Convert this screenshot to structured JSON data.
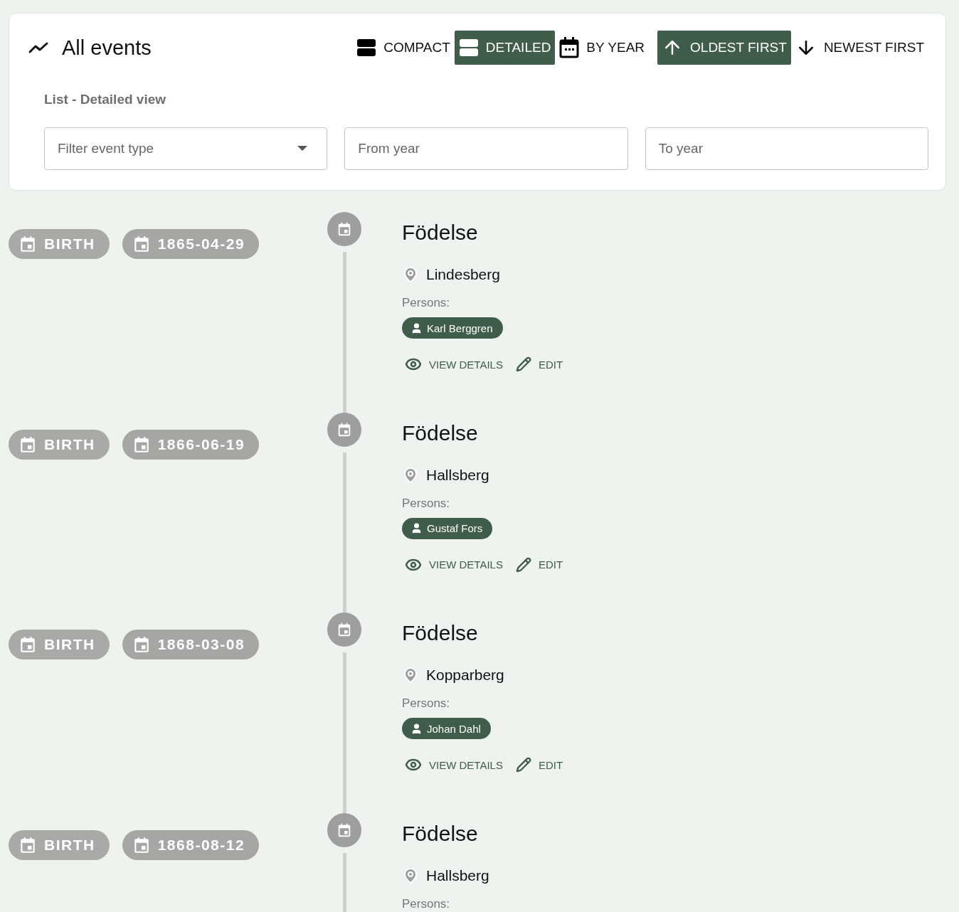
{
  "header": {
    "title": "All events",
    "subtitle": "List - Detailed view"
  },
  "view_buttons": [
    {
      "kind": "compact",
      "label": "COMPACT",
      "selected": false
    },
    {
      "kind": "detailed",
      "label": "DETAILED",
      "selected": true
    },
    {
      "kind": "year",
      "label": "BY YEAR",
      "selected": false
    }
  ],
  "sort_buttons": [
    {
      "kind": "oldest",
      "label": "OLDEST FIRST",
      "selected": true
    },
    {
      "kind": "newest",
      "label": "NEWEST FIRST",
      "selected": false
    }
  ],
  "filters": [
    {
      "kind": "select",
      "placeholder": "Filter event type"
    },
    {
      "kind": "text",
      "placeholder": "From year"
    },
    {
      "kind": "text",
      "placeholder": "To year"
    }
  ],
  "events": [
    {
      "type": "BIRTH",
      "date": "1865-04-29",
      "title": "Födelse",
      "place": "Lindesberg",
      "persons_label": "Persons:",
      "persons": [
        "Karl Berggren"
      ],
      "actions": [
        {
          "kind": "view",
          "label": "VIEW DETAILS"
        },
        {
          "kind": "edit",
          "label": "EDIT"
        }
      ]
    },
    {
      "type": "BIRTH",
      "date": "1866-06-19",
      "title": "Födelse",
      "place": "Hallsberg",
      "persons_label": "Persons:",
      "persons": [
        "Gustaf Fors"
      ],
      "actions": [
        {
          "kind": "view",
          "label": "VIEW DETAILS"
        },
        {
          "kind": "edit",
          "label": "EDIT"
        }
      ]
    },
    {
      "type": "BIRTH",
      "date": "1868-03-08",
      "title": "Födelse",
      "place": "Kopparberg",
      "persons_label": "Persons:",
      "persons": [
        "Johan Dahl"
      ],
      "actions": [
        {
          "kind": "view",
          "label": "VIEW DETAILS"
        },
        {
          "kind": "edit",
          "label": "EDIT"
        }
      ]
    },
    {
      "type": "BIRTH",
      "date": "1868-08-12",
      "title": "Födelse",
      "place": "Hallsberg",
      "persons_label": "Persons:"
    }
  ]
}
